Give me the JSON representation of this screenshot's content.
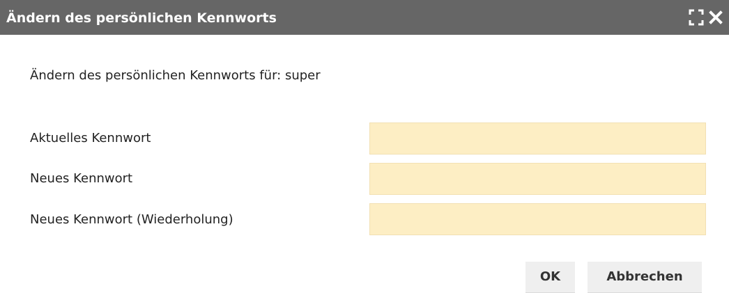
{
  "dialog": {
    "title": "Ändern des persönlichen Kennworts",
    "maximize_icon": "maximize-icon",
    "close_icon": "close-icon",
    "title_bar_color": "#666666"
  },
  "form": {
    "subtitle": "Ändern des persönlichen Kennworts für: super",
    "fields": [
      {
        "label": "Aktuelles Kennwort",
        "value": ""
      },
      {
        "label": "Neues Kennwort",
        "value": ""
      },
      {
        "label": "Neues Kennwort (Wiederholung)",
        "value": ""
      }
    ],
    "field_background": "#fdeec4"
  },
  "buttons": {
    "ok_label": "OK",
    "cancel_label": "Abbrechen"
  }
}
